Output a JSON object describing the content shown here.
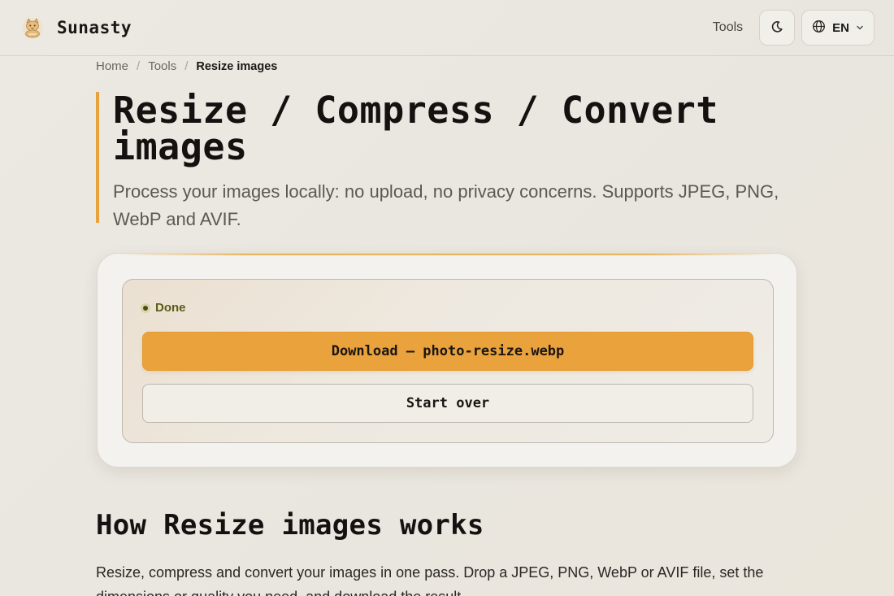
{
  "header": {
    "brand_name": "Sunasty",
    "logo_icon": "cat-logo-icon",
    "nav_tools": "Tools",
    "theme_icon": "moon-icon",
    "lang_icon": "globe-icon",
    "lang_code": "EN",
    "lang_chevron_icon": "chevron-down-icon"
  },
  "breadcrumb": {
    "items": [
      "Home",
      "Tools",
      "Resize images"
    ],
    "separator": "/"
  },
  "hero": {
    "title": "Resize / Compress / Convert images",
    "subtitle": "Process your images locally: no upload, no privacy concerns. Supports JPEG, PNG, WebP and AVIF."
  },
  "result": {
    "status": "Done",
    "download_label": "Download — photo-resize.webp",
    "start_over_label": "Start over"
  },
  "how": {
    "title": "How Resize images works",
    "text": "Resize, compress and convert your images in one pass. Drop a JPEG, PNG, WebP or AVIF file, set the dimensions or quality you need, and download the result."
  },
  "colors": {
    "accent": "#e9a23c",
    "status_text": "#5f5a18",
    "background": "#ece9e3"
  }
}
